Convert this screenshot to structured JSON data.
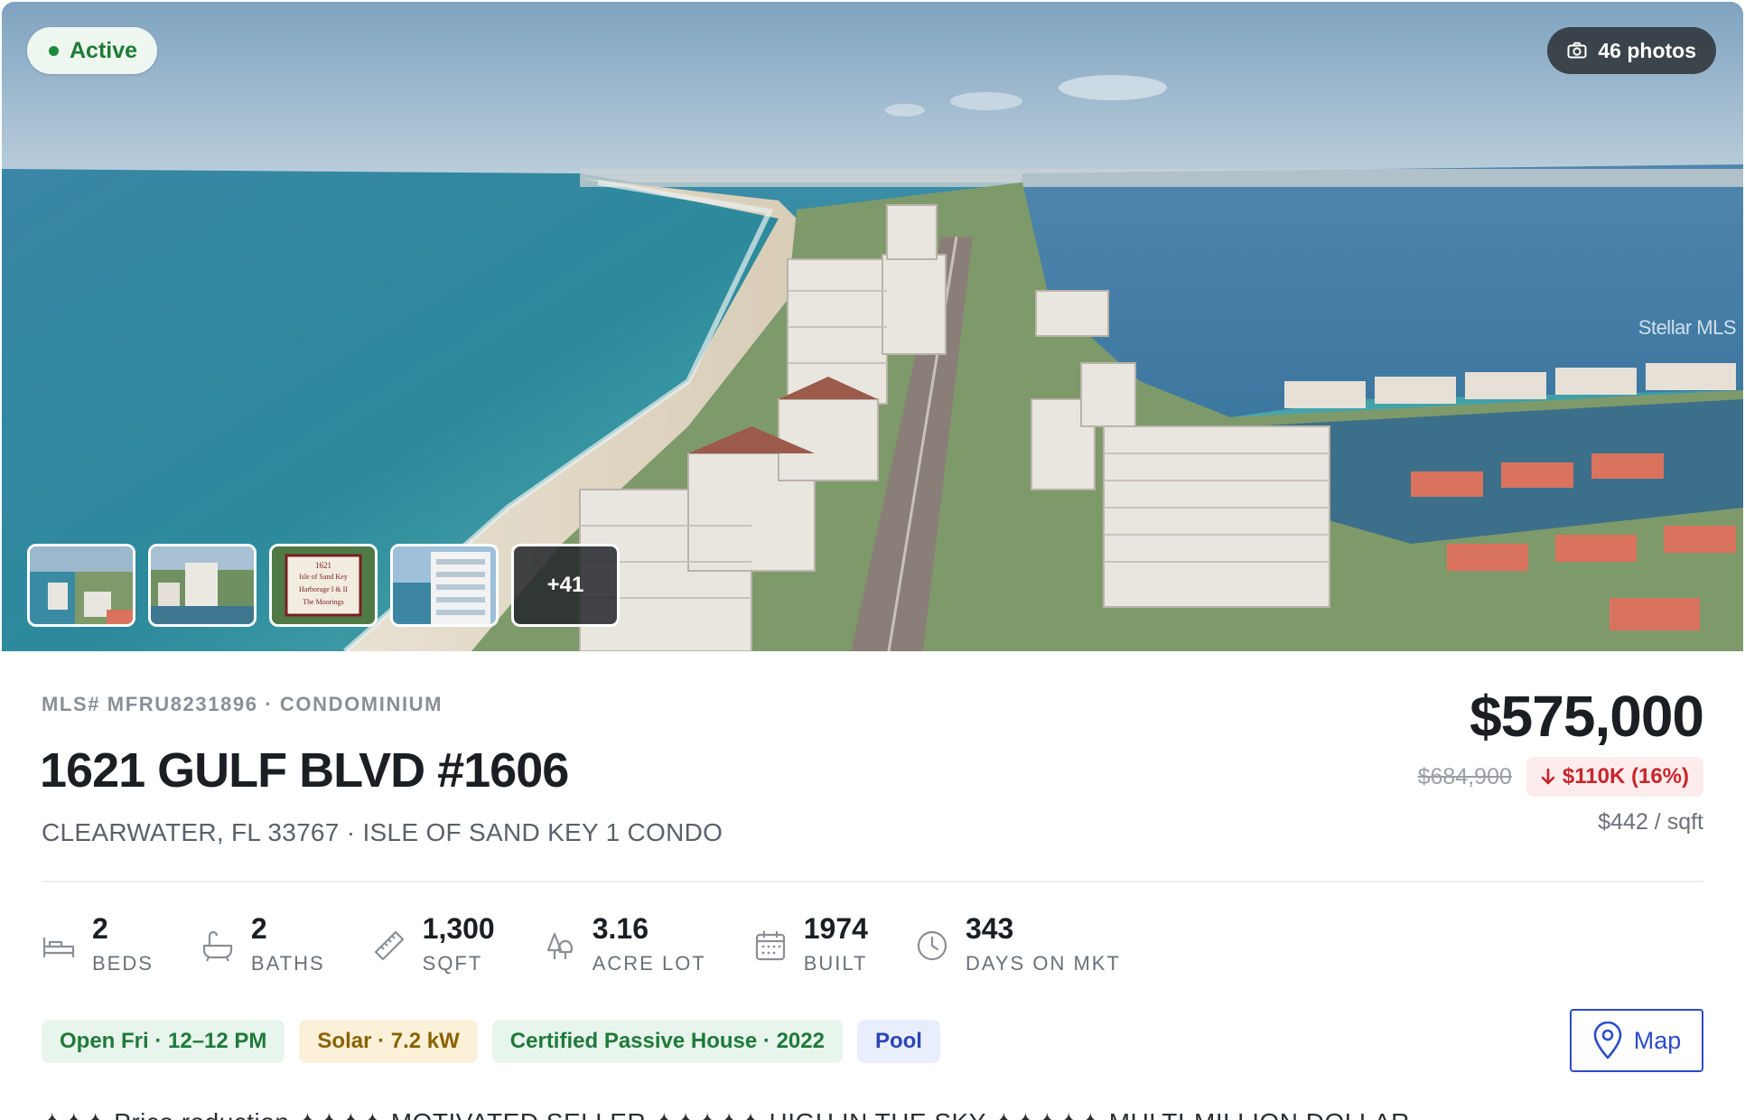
{
  "hero": {
    "status_label": "Active",
    "photos_label": "46 photos",
    "watermark": "Stellar MLS",
    "thumbnails": [
      {
        "alt": "Aerial beach view"
      },
      {
        "alt": "Aerial tower view"
      },
      {
        "alt": "Entrance sign",
        "sign_lines": [
          "1621",
          "Isle of Sand Key",
          "Harborage I & II",
          "The Moorings"
        ]
      },
      {
        "alt": "Building facade"
      }
    ],
    "more_label": "+41"
  },
  "listing": {
    "meta": "MLS# MFRU8231896 · CONDOMINIUM",
    "title": "1621 GULF BLVD #1606",
    "subtitle": "CLEARWATER, FL 33767 · ISLE OF SAND KEY 1 CONDO",
    "price": "$575,000",
    "old_price": "$684,900",
    "price_drop": "$110K (16%)",
    "price_per_sqft": "$442 / sqft"
  },
  "stats": [
    {
      "icon": "bed-icon",
      "value": "2",
      "label": "BEDS"
    },
    {
      "icon": "bath-icon",
      "value": "2",
      "label": "BATHS"
    },
    {
      "icon": "ruler-icon",
      "value": "1,300",
      "label": "SQFT"
    },
    {
      "icon": "trees-icon",
      "value": "3.16",
      "label": "ACRE LOT"
    },
    {
      "icon": "calendar-icon",
      "value": "1974",
      "label": "BUILT"
    },
    {
      "icon": "clock-icon",
      "value": "343",
      "label": "DAYS ON MKT"
    }
  ],
  "chips": [
    {
      "label": "Open Fri · 12–12 PM",
      "tone": "green"
    },
    {
      "label": "Solar · 7.2 kW",
      "tone": "yellow"
    },
    {
      "label": "Certified Passive House · 2022",
      "tone": "green"
    },
    {
      "label": "Pool",
      "tone": "blue"
    }
  ],
  "actions": {
    "map_label": "Map"
  },
  "description_clip": "✦✦✦ Price reduction ✦✦✦✦ MOTIVATED SELLER ✦✦✦✦✦ HIGH IN THE SKY ✦✦✦✦✦ MULTI-MILLION DOLLAR",
  "colors": {
    "accent": "#2d4cc8",
    "active_green": "#1e8a3c",
    "drop_red": "#c8252c"
  }
}
